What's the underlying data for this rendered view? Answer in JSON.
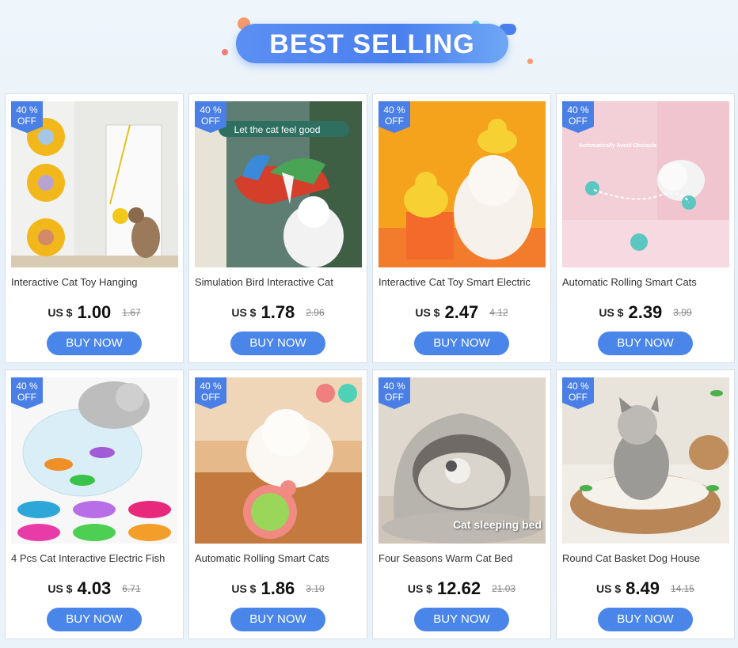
{
  "header": {
    "title": "BEST SELLING"
  },
  "colors": {
    "accent": "#4a86ea",
    "badge": "#4a7fe6"
  },
  "products": [
    {
      "badge_pct": "40 %",
      "badge_off": "OFF",
      "title": "Interactive Cat Toy Hanging",
      "currency": "US $",
      "price": "1.00",
      "old_price": "1.67",
      "button": "BUY NOW",
      "image": "hanging-cat-toy-image"
    },
    {
      "badge_pct": "40 %",
      "badge_off": "OFF",
      "title": "Simulation Bird Interactive Cat",
      "currency": "US $",
      "price": "1.78",
      "old_price": "2.96",
      "button": "BUY NOW",
      "image": "bird-toy-image",
      "image_caption": "Let the cat feel good"
    },
    {
      "badge_pct": "40 %",
      "badge_off": "OFF",
      "title": "Interactive Cat Toy Smart Electric",
      "currency": "US $",
      "price": "2.47",
      "old_price": "4.12",
      "button": "BUY NOW",
      "image": "duck-toy-image"
    },
    {
      "badge_pct": "40 %",
      "badge_off": "OFF",
      "title": "Automatic Rolling Smart Cats",
      "currency": "US $",
      "price": "2.39",
      "old_price": "3.99",
      "button": "BUY NOW",
      "image": "rolling-ball-image",
      "image_caption": "Automatically Avoid Obstacle"
    },
    {
      "badge_pct": "40 %",
      "badge_off": "OFF",
      "title": "4 Pcs Cat Interactive Electric Fish",
      "currency": "US $",
      "price": "4.03",
      "old_price": "6.71",
      "button": "BUY NOW",
      "image": "electric-fish-image"
    },
    {
      "badge_pct": "40 %",
      "badge_off": "OFF",
      "title": "Automatic Rolling Smart Cats",
      "currency": "US $",
      "price": "1.86",
      "old_price": "3.10",
      "button": "BUY NOW",
      "image": "smart-ball-image"
    },
    {
      "badge_pct": "40 %",
      "badge_off": "OFF",
      "title": "Four Seasons Warm Cat Bed",
      "currency": "US $",
      "price": "12.62",
      "old_price": "21.03",
      "button": "BUY NOW",
      "image": "cat-bed-image",
      "image_caption": "Cat sleeping bed"
    },
    {
      "badge_pct": "40 %",
      "badge_off": "OFF",
      "title": "Round Cat Basket Dog House",
      "currency": "US $",
      "price": "8.49",
      "old_price": "14.15",
      "button": "BUY NOW",
      "image": "cat-basket-image"
    }
  ]
}
